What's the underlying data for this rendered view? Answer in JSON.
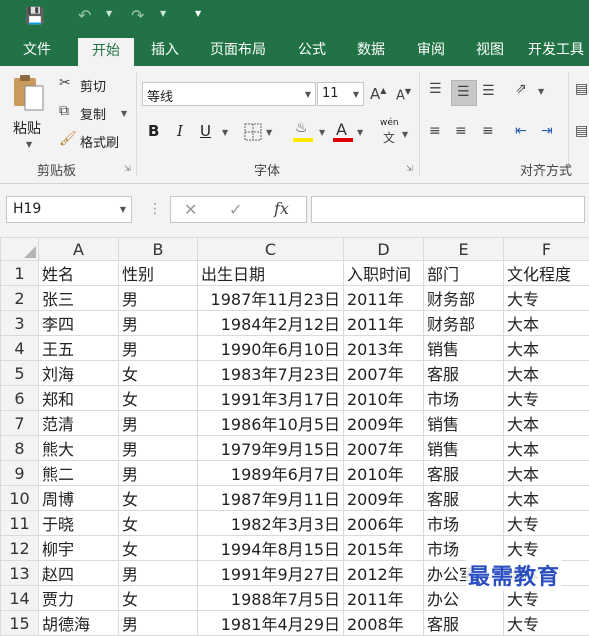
{
  "quick_access": {
    "save_icon": "save-icon",
    "undo_icon": "undo-icon",
    "redo_icon": "redo-icon",
    "customize_icon": "customize-qat-icon"
  },
  "tabs": [
    "文件",
    "开始",
    "插入",
    "页面布局",
    "公式",
    "数据",
    "审阅",
    "视图",
    "开发工具"
  ],
  "active_tab": "开始",
  "ribbon": {
    "clipboard": {
      "paste": "粘贴",
      "cut": "剪切",
      "copy": "复制",
      "format_painter": "格式刷",
      "group_label": "剪贴板"
    },
    "font": {
      "font_name": "等线",
      "font_size": "11",
      "bold": "B",
      "italic": "I",
      "underline": "U",
      "group_label": "字体",
      "phonetic": "wén"
    },
    "alignment": {
      "group_label": "对齐方式"
    }
  },
  "formula_bar": {
    "name_box": "H19",
    "cancel": "✕",
    "enter": "✓",
    "fx": "fx",
    "formula": ""
  },
  "sheet": {
    "columns": [
      "A",
      "B",
      "C",
      "D",
      "E",
      "F"
    ],
    "rows": [
      {
        "n": "1",
        "cells": [
          "姓名",
          "性别",
          "出生日期",
          "入职时间",
          "部门",
          "文化程度"
        ]
      },
      {
        "n": "2",
        "cells": [
          "张三",
          "男",
          "1987年11月23日",
          "2011年",
          "财务部",
          "大专"
        ]
      },
      {
        "n": "3",
        "cells": [
          "李四",
          "男",
          "1984年2月12日",
          "2011年",
          "财务部",
          "大本"
        ]
      },
      {
        "n": "4",
        "cells": [
          "王五",
          "男",
          "1990年6月10日",
          "2013年",
          "销售",
          "大本"
        ]
      },
      {
        "n": "5",
        "cells": [
          "刘海",
          "女",
          "1983年7月23日",
          "2007年",
          "客服",
          "大本"
        ]
      },
      {
        "n": "6",
        "cells": [
          "郑和",
          "女",
          "1991年3月17日",
          "2010年",
          "市场",
          "大专"
        ]
      },
      {
        "n": "7",
        "cells": [
          "范清",
          "男",
          "1986年10月5日",
          "2009年",
          "销售",
          "大本"
        ]
      },
      {
        "n": "8",
        "cells": [
          "熊大",
          "男",
          "1979年9月15日",
          "2007年",
          "销售",
          "大本"
        ]
      },
      {
        "n": "9",
        "cells": [
          "熊二",
          "男",
          "1989年6月7日",
          "2010年",
          "客服",
          "大本"
        ]
      },
      {
        "n": "10",
        "cells": [
          "周博",
          "女",
          "1987年9月11日",
          "2009年",
          "客服",
          "大本"
        ]
      },
      {
        "n": "11",
        "cells": [
          "于晓",
          "女",
          "1982年3月3日",
          "2006年",
          "市场",
          "大专"
        ]
      },
      {
        "n": "12",
        "cells": [
          "柳宇",
          "女",
          "1994年8月15日",
          "2015年",
          "市场",
          "大专"
        ]
      },
      {
        "n": "13",
        "cells": [
          "赵四",
          "男",
          "1991年9月27日",
          "2012年",
          "办公室",
          "大本"
        ]
      },
      {
        "n": "14",
        "cells": [
          "贾力",
          "女",
          "1988年7月5日",
          "2011年",
          "办公",
          "大专"
        ]
      },
      {
        "n": "15",
        "cells": [
          "胡德海",
          "男",
          "1981年4月29日",
          "2008年",
          "客服",
          "大专"
        ]
      }
    ]
  },
  "watermark": "最需教育",
  "colors": {
    "excel_green": "#217346",
    "ribbon_bg": "#f3f3f3",
    "grid_line": "#dadada",
    "watermark": "#2a4ec0"
  }
}
